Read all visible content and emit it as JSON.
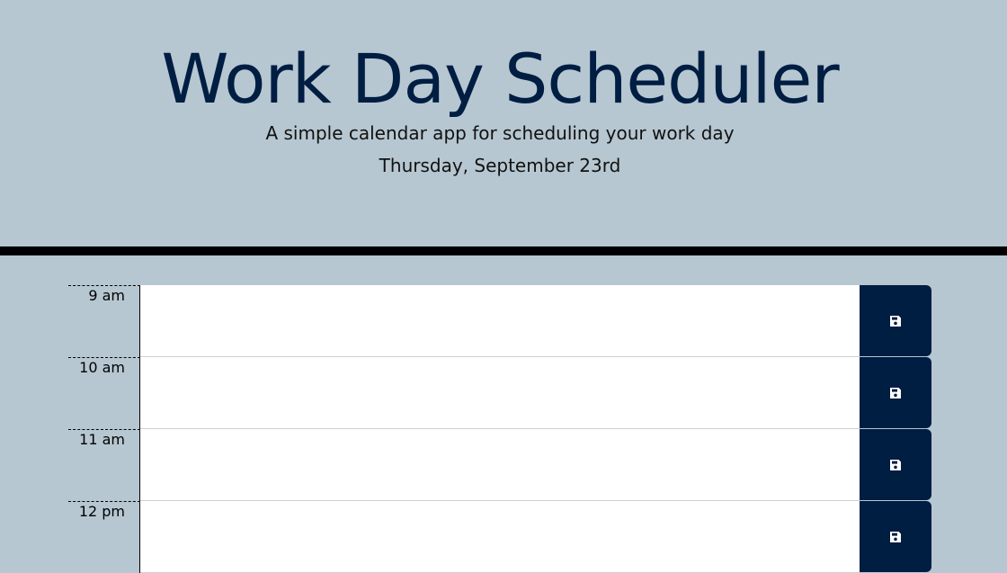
{
  "header": {
    "title": "Work Day Scheduler",
    "subtitle": "A simple calendar app for scheduling your work day",
    "current_day": "Thursday, September 23rd"
  },
  "time_blocks": [
    {
      "hour": "9 am",
      "text": "",
      "save_icon": "save-icon"
    },
    {
      "hour": "10 am",
      "text": "",
      "save_icon": "save-icon"
    },
    {
      "hour": "11 am",
      "text": "",
      "save_icon": "save-icon"
    },
    {
      "hour": "12 pm",
      "text": "",
      "save_icon": "save-icon"
    }
  ],
  "colors": {
    "background": "#b6c7d1",
    "accent": "#001d42",
    "divider": "#000000",
    "text_block": "#ffffff"
  }
}
